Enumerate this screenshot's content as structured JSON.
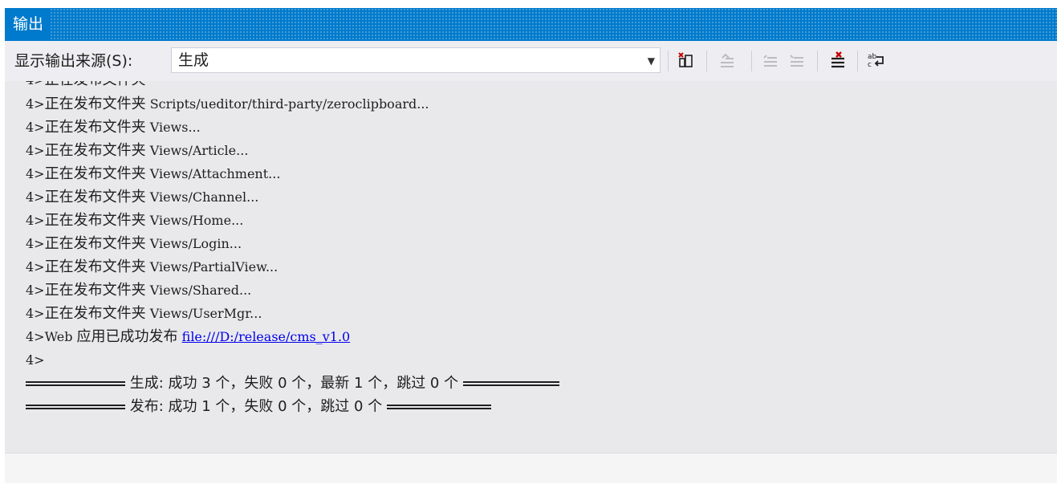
{
  "title": "输出",
  "toolbar": {
    "source_label": "显示输出来源(S):",
    "source_value": "生成"
  },
  "output": {
    "clipped_prefix": "4>",
    "clipped_text": "正在发布文件夹",
    "lines": [
      {
        "prefix": "4>",
        "text": "正在发布文件夹",
        "path": "Scripts/ueditor/third-party/zeroclipboard..."
      },
      {
        "prefix": "4>",
        "text": "正在发布文件夹",
        "path": "Views..."
      },
      {
        "prefix": "4>",
        "text": "正在发布文件夹",
        "path": "Views/Article..."
      },
      {
        "prefix": "4>",
        "text": "正在发布文件夹",
        "path": "Views/Attachment..."
      },
      {
        "prefix": "4>",
        "text": "正在发布文件夹",
        "path": "Views/Channel..."
      },
      {
        "prefix": "4>",
        "text": "正在发布文件夹",
        "path": "Views/Home..."
      },
      {
        "prefix": "4>",
        "text": "正在发布文件夹",
        "path": "Views/Login..."
      },
      {
        "prefix": "4>",
        "text": "正在发布文件夹",
        "path": "Views/PartialView..."
      },
      {
        "prefix": "4>",
        "text": "正在发布文件夹",
        "path": "Views/Shared..."
      },
      {
        "prefix": "4>",
        "text": "正在发布文件夹",
        "path": "Views/UserMgr..."
      }
    ],
    "web_line": {
      "prefix": "4>",
      "web": "Web",
      "text": "应用已成功发布",
      "link": "file:///D:/release/cms_v1.0"
    },
    "empty_prompt": "4>",
    "build_summary": "生成: 成功 3 个，失败 0 个，最新 1 个，跳过 0 个",
    "publish_summary": "发布: 成功 1 个，失败 0 个，跳过 0 个"
  }
}
